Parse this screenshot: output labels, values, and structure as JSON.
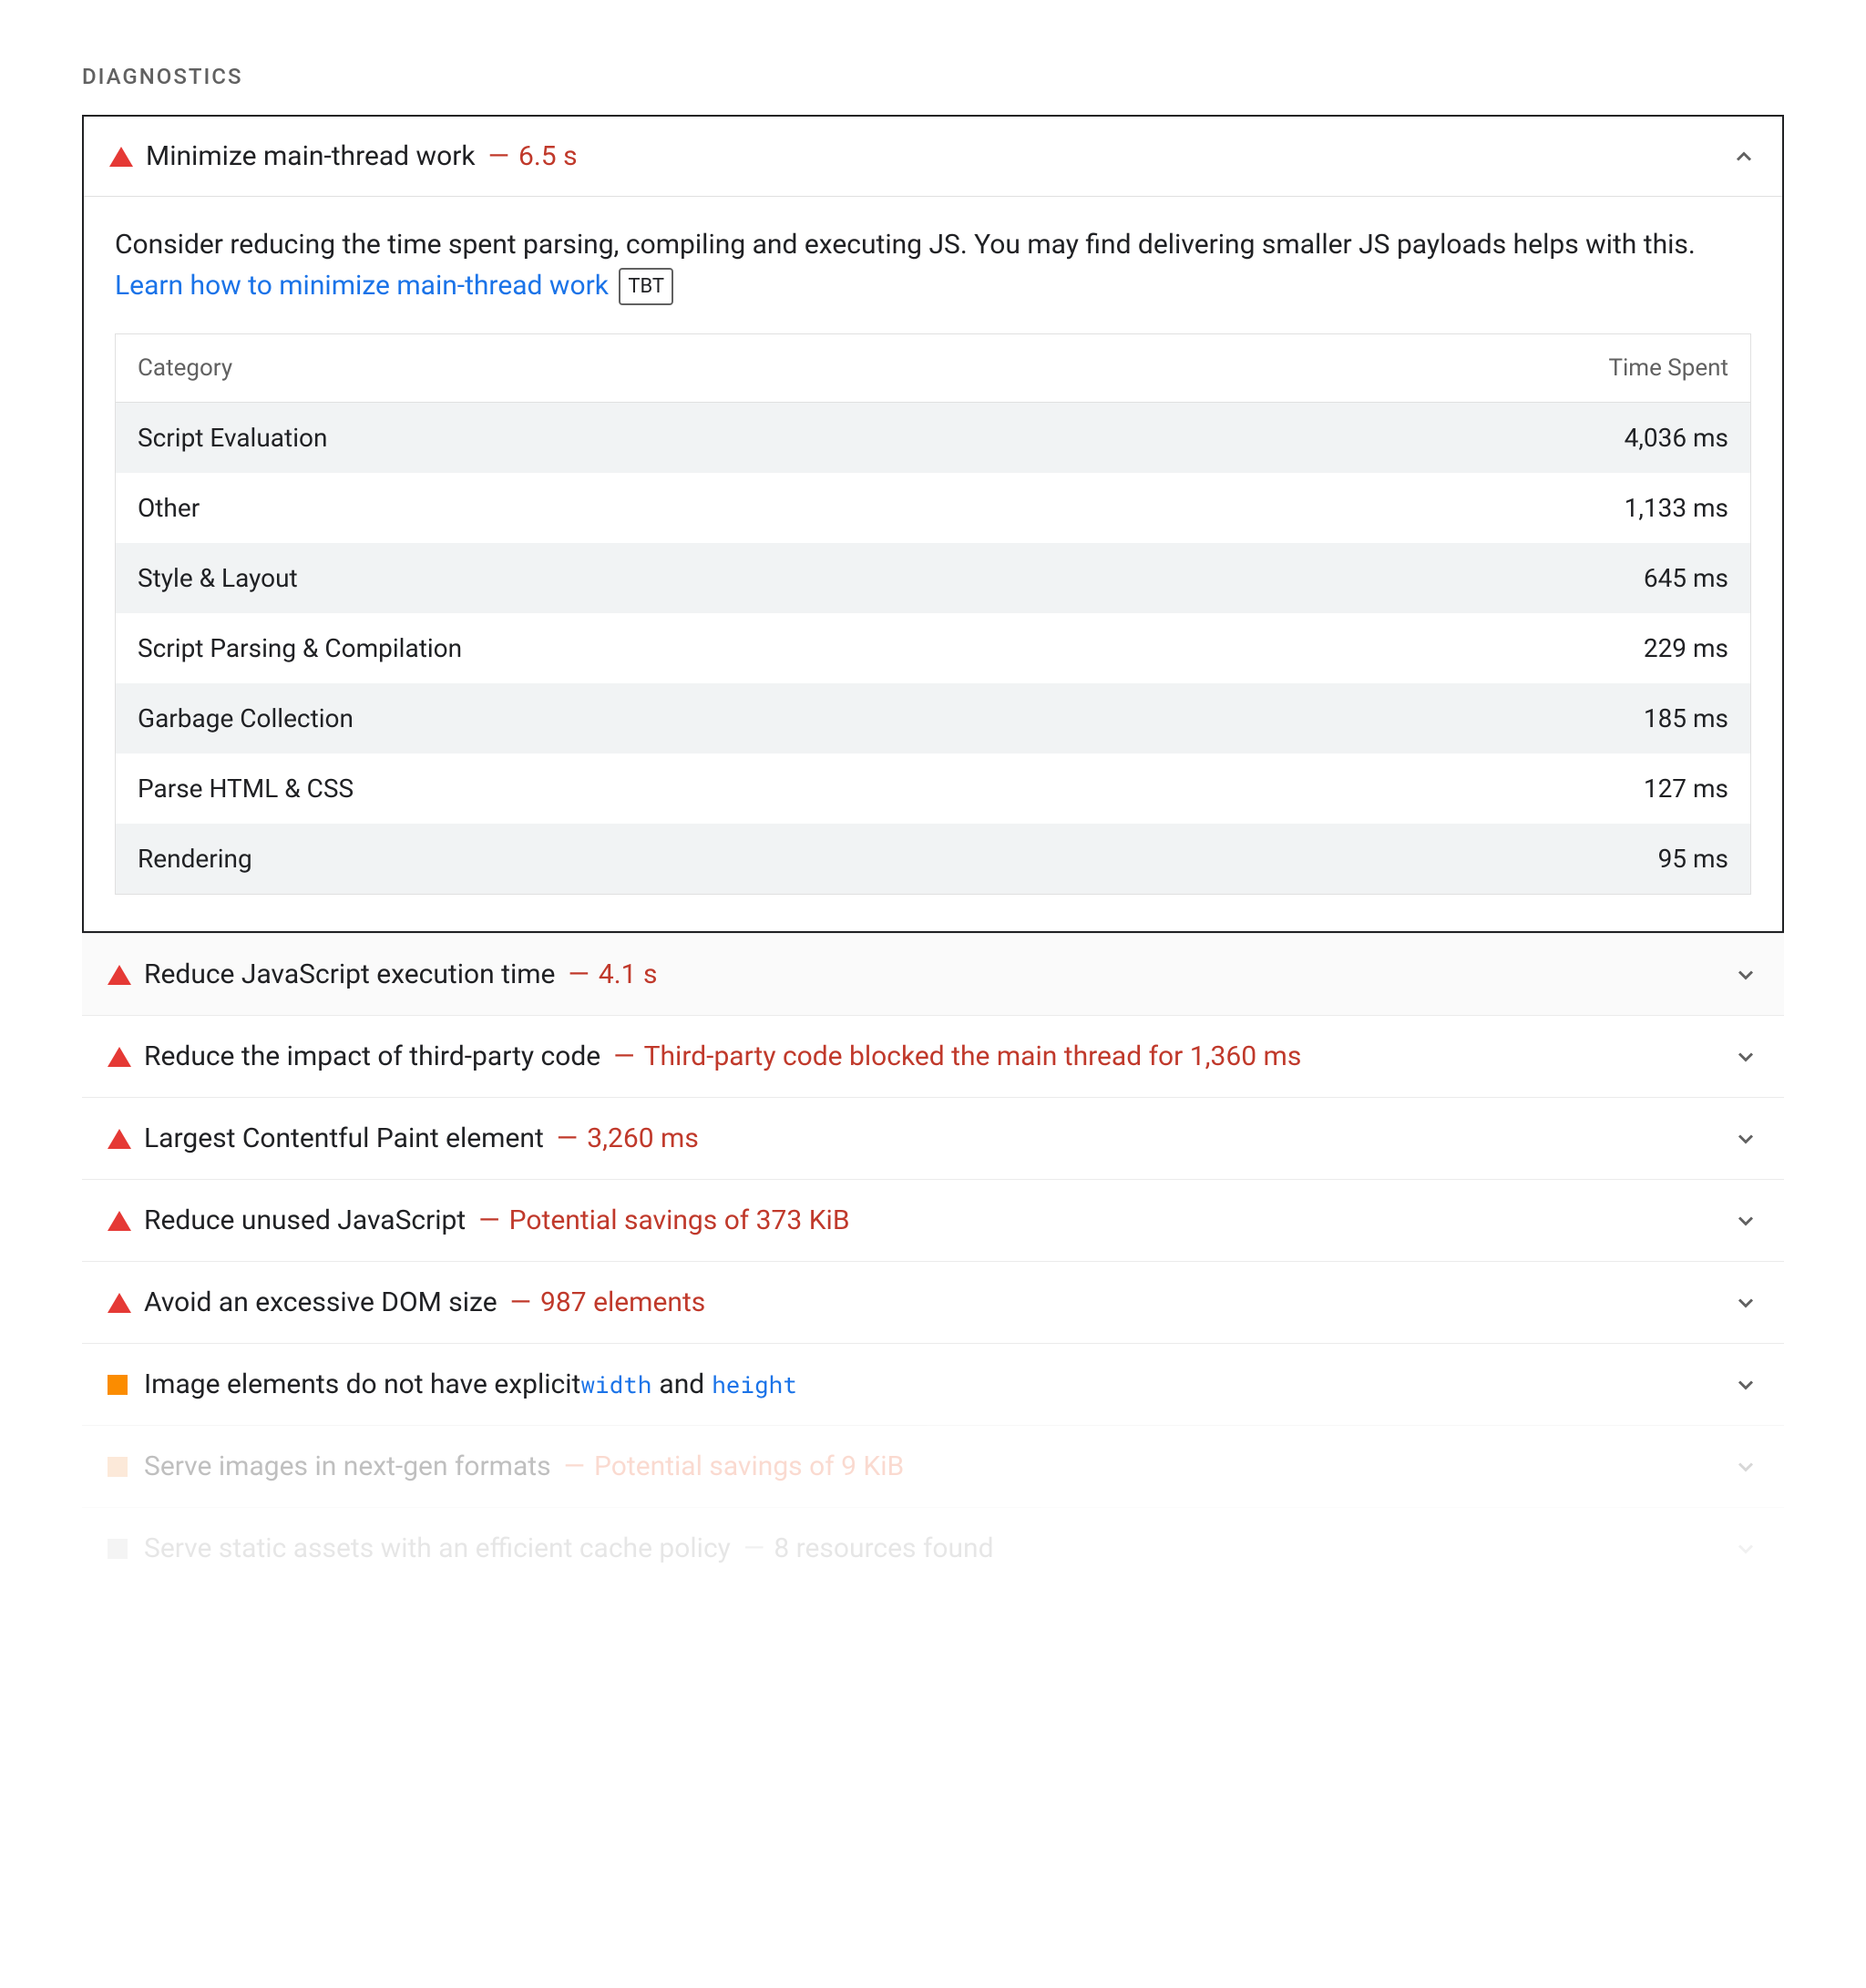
{
  "section_title": "DIAGNOSTICS",
  "expanded": {
    "title": "Minimize main-thread work",
    "metric": "6.5 s",
    "description_prefix": "Consider reducing the time spent parsing, compiling and executing JS. You may find delivering smaller JS payloads helps with this. ",
    "link_text": "Learn how to minimize main-thread work",
    "badge": "TBT",
    "table": {
      "header_left": "Category",
      "header_right": "Time Spent",
      "rows": [
        {
          "category": "Script Evaluation",
          "time": "4,036 ms"
        },
        {
          "category": "Other",
          "time": "1,133 ms"
        },
        {
          "category": "Style & Layout",
          "time": "645 ms"
        },
        {
          "category": "Script Parsing & Compilation",
          "time": "229 ms"
        },
        {
          "category": "Garbage Collection",
          "time": "185 ms"
        },
        {
          "category": "Parse HTML & CSS",
          "time": "127 ms"
        },
        {
          "category": "Rendering",
          "time": "95 ms"
        }
      ]
    }
  },
  "rows": [
    {
      "title": "Reduce JavaScript execution time",
      "metric": "4.1 s"
    },
    {
      "title": "Reduce the impact of third-party code",
      "metric": "Third-party code blocked the main thread for 1,360 ms"
    },
    {
      "title": "Largest Contentful Paint element",
      "metric": "3,260 ms"
    },
    {
      "title": "Reduce unused JavaScript",
      "metric": "Potential savings of 373 KiB"
    },
    {
      "title": "Avoid an excessive DOM size",
      "metric": "987 elements"
    }
  ],
  "image_row": {
    "prefix": "Image elements do not have explicit ",
    "attr1": "width",
    "and": " and ",
    "attr2": "height"
  },
  "faded1": {
    "title": "Serve images in next-gen formats",
    "metric": "Potential savings of 9 KiB"
  },
  "faded2": {
    "title": "Serve static assets with an efficient cache policy",
    "metric": "8 resources found"
  },
  "dash": "—",
  "chart_data": {
    "type": "table",
    "title": "Minimize main-thread work — Time Spent by Category",
    "columns": [
      "Category",
      "Time Spent (ms)"
    ],
    "rows": [
      [
        "Script Evaluation",
        4036
      ],
      [
        "Other",
        1133
      ],
      [
        "Style & Layout",
        645
      ],
      [
        "Script Parsing & Compilation",
        229
      ],
      [
        "Garbage Collection",
        185
      ],
      [
        "Parse HTML & CSS",
        127
      ],
      [
        "Rendering",
        95
      ]
    ]
  }
}
